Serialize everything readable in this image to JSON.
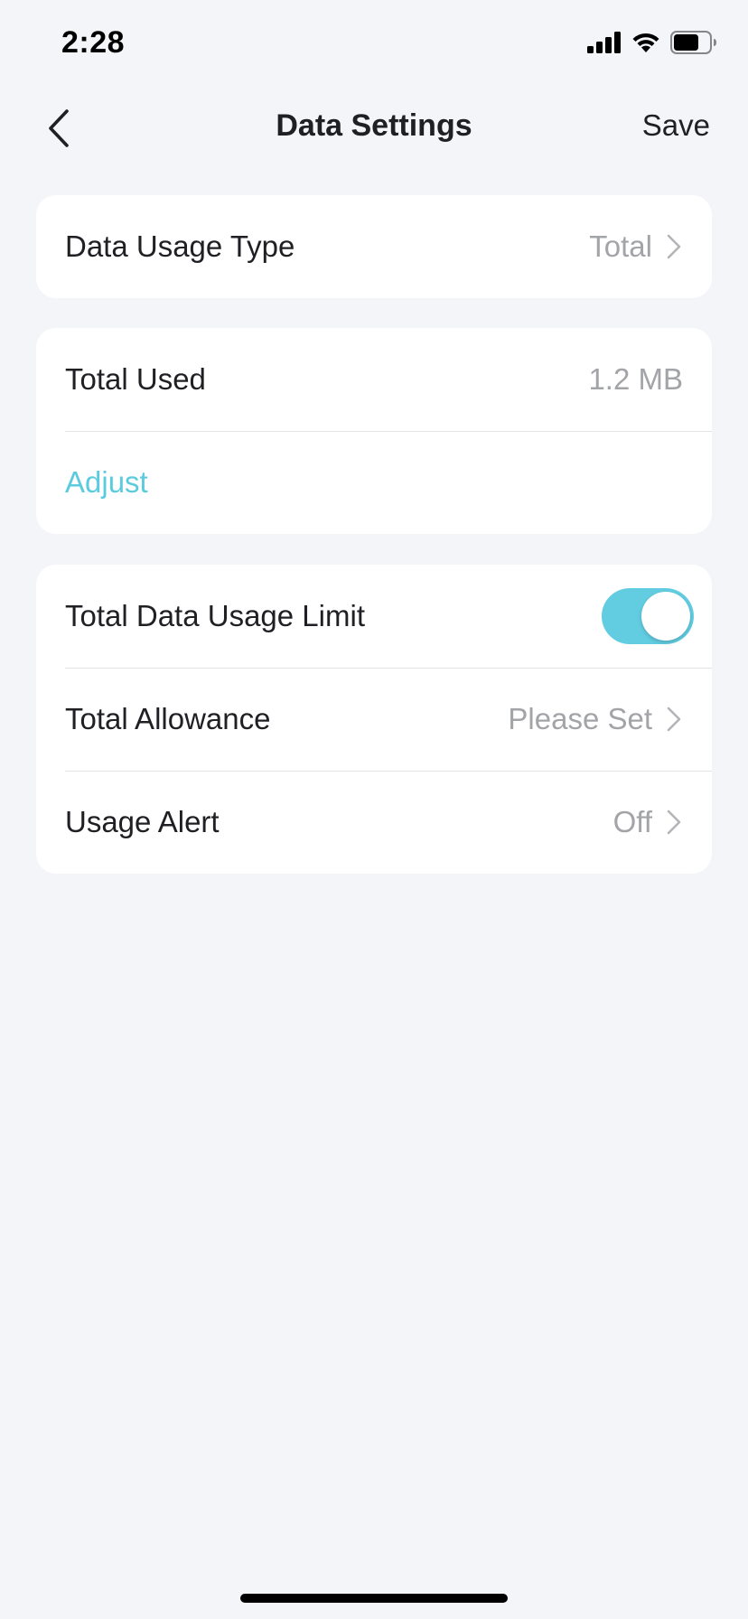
{
  "status_bar": {
    "time": "2:28",
    "icons": [
      "cellular-signal-icon",
      "wifi-icon",
      "battery-icon"
    ]
  },
  "nav": {
    "back_icon": "chevron-left-icon",
    "title": "Data Settings",
    "save_label": "Save"
  },
  "data_usage_type": {
    "label": "Data Usage Type",
    "value": "Total"
  },
  "usage": {
    "total_used_label": "Total Used",
    "total_used_value": "1.2 MB",
    "adjust_label": "Adjust"
  },
  "limits": {
    "limit_label": "Total Data Usage Limit",
    "limit_enabled": true,
    "allowance_label": "Total Allowance",
    "allowance_value": "Please Set",
    "alert_label": "Usage Alert",
    "alert_value": "Off"
  },
  "colors": {
    "accent": "#5ccbe0",
    "toggle_on": "#62cce1",
    "background": "#f4f5f9",
    "secondary_text": "#a3a4a8"
  }
}
